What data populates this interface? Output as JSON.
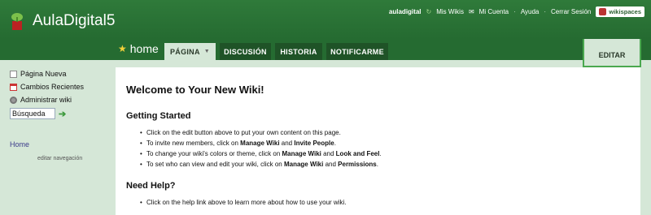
{
  "header": {
    "site_title": "AulaDigital5",
    "user": "auladigital",
    "links": [
      "Mis Wikis",
      "Mi Cuenta",
      "Ayuda",
      "Cerrar Sesión"
    ],
    "badge": "wikispaces"
  },
  "tabbar": {
    "home_label": "home",
    "tabs": [
      "PÁGINA",
      "DISCUSIÓN",
      "HISTORIA",
      "NOTIFICARME"
    ],
    "edit_label": "EDITAR"
  },
  "sidebar": {
    "items": [
      "Página Nueva",
      "Cambios Recientes",
      "Administrar wiki"
    ],
    "search_value": "Búsqueda",
    "nav_home": "Home",
    "edit_nav": "editar navegación"
  },
  "content": {
    "title": "Welcome to Your New Wiki!",
    "getting_started": {
      "heading": "Getting Started",
      "items": [
        {
          "parts": [
            "Click on the edit button above to put your own content on this page."
          ]
        },
        {
          "parts": [
            "To invite new members, click on ",
            "Manage Wiki",
            " and ",
            "Invite People",
            "."
          ]
        },
        {
          "parts": [
            "To change your wiki's colors or theme, click on ",
            "Manage Wiki",
            " and ",
            "Look and Feel",
            "."
          ]
        },
        {
          "parts": [
            "To set who can view and edit your wiki, click on ",
            "Manage Wiki",
            " and ",
            "Permissions",
            "."
          ]
        }
      ]
    },
    "need_help": {
      "heading": "Need Help?",
      "items": [
        "Click on the help link above to learn more about how to use your wiki."
      ]
    }
  },
  "colors": {
    "header_green": "#256b31",
    "tab_dark": "#1f5327",
    "page_bg": "#d5e7d7",
    "edit_border": "#4aa84f"
  }
}
